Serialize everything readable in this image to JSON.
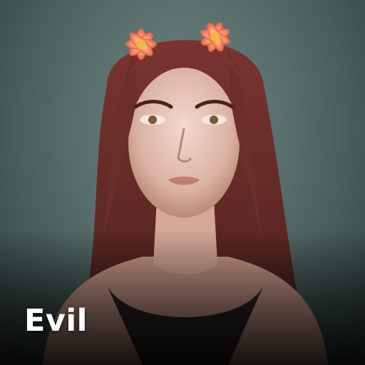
{
  "card": {
    "caption": "Evil",
    "caption_color": "#ffffff",
    "background_color": "#566c69",
    "hair_color": "#6b2e2a",
    "flower_color": "#ff8a5c"
  }
}
